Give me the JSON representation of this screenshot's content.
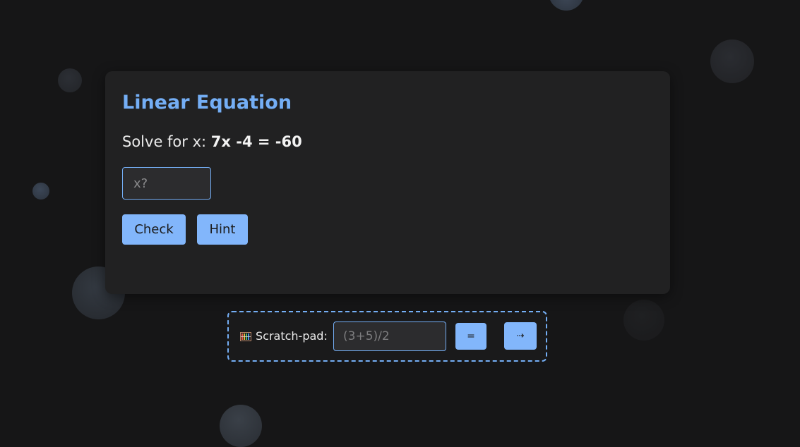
{
  "card": {
    "title": "Linear Equation",
    "question_prefix": "Solve for x:",
    "equation": "7x -4 = -60",
    "answer_placeholder": "x?",
    "check_label": "Check",
    "hint_label": "Hint"
  },
  "scratchpad": {
    "icon": "abacus-icon",
    "label": "Scratch-pad:",
    "input_placeholder": "(3+5)/2",
    "equals_label": "=",
    "arrow_label": "⇢"
  },
  "colors": {
    "background": "#161617",
    "card": "#212122",
    "accent": "#74aef5",
    "button": "#82b6fb"
  }
}
